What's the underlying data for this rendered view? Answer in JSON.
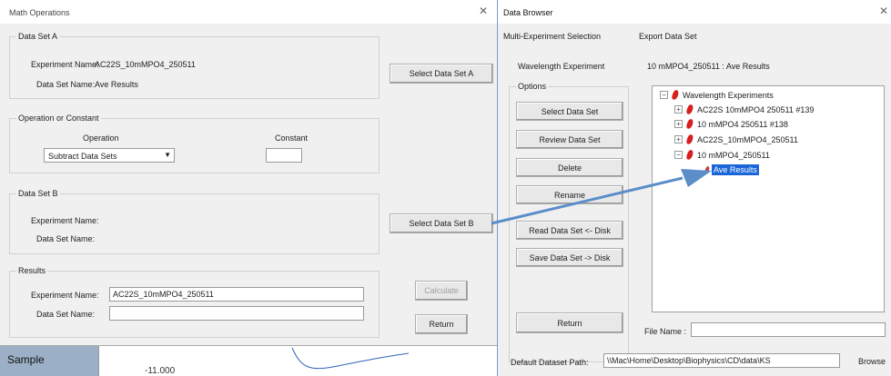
{
  "math_window": {
    "title": "Math Operations",
    "close_glyph": "✕",
    "data_set_a": {
      "legend": "Data Set A",
      "experiment_label": "Experiment Name:",
      "experiment_value": "AC22S_10mMPO4_250511",
      "dataset_label": "Data Set Name:",
      "dataset_value": "Ave Results"
    },
    "select_a_label": "Select Data Set A",
    "operation": {
      "legend": "Operation or Constant",
      "operation_label": "Operation",
      "operation_value": "Subtract Data Sets",
      "constant_label": "Constant",
      "constant_value": ""
    },
    "data_set_b": {
      "legend": "Data Set B",
      "experiment_label": "Experiment Name:",
      "dataset_label": "Data Set Name:"
    },
    "select_b_label": "Select Data Set B",
    "results": {
      "legend": "Results",
      "experiment_label": "Experiment Name:",
      "experiment_value": "AC22S_10mMPO4_250511",
      "dataset_label": "Data Set Name:",
      "dataset_value": ""
    },
    "calculate_label": "Calculate",
    "return_label": "Return"
  },
  "background": {
    "sample_label": "Sample",
    "axis_value": "-11.000"
  },
  "browser_window": {
    "title": "Data Browser",
    "close_glyph": "✕",
    "menu": [
      "Multi-Experiment Selection",
      "Export Data Set"
    ],
    "wavelength_label": "Wavelength Experiment",
    "wavelength_value": "10 mMPO4_250511 : Ave Results",
    "options_legend": "Options",
    "buttons": {
      "select": "Select Data Set",
      "review": "Review Data Set",
      "delete": "Delete",
      "rename": "Rename",
      "read": "Read Data Set <- Disk",
      "save": "Save Data Set -> Disk",
      "return": "Return"
    },
    "tree": {
      "root": "Wavelength Experiments",
      "items": [
        "AC22S 10mMPO4 250511 #139",
        "10 mMPO4 250511 #138",
        "AC22S_10mMPO4_250511",
        "10 mMPO4_250511"
      ],
      "selected": "Ave Results"
    },
    "file_name_label": "File Name :",
    "file_name_value": "",
    "path_label": "Default Dataset Path:",
    "path_value": "\\\\Mac\\Home\\Desktop\\Biophysics\\CD\\data\\KS",
    "browse_label": "Browse"
  },
  "colors": {
    "arrow": "#5b8ec8",
    "selection": "#1a66d9",
    "pepper": "#d81e1e",
    "trace": "#2f63b8"
  }
}
